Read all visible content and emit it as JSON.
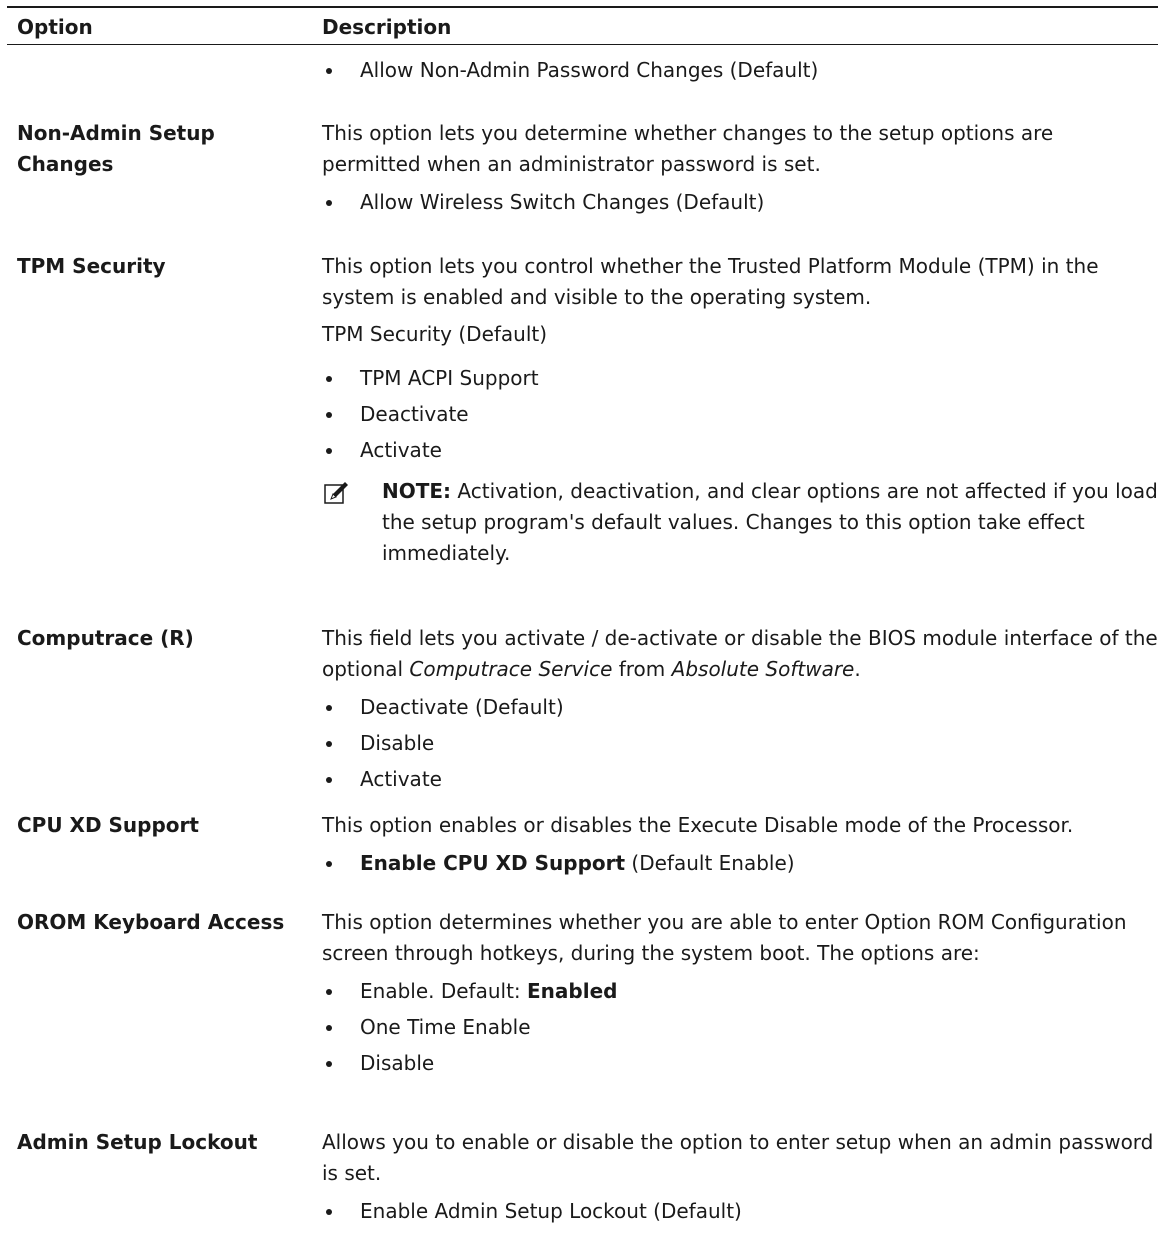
{
  "header": {
    "option": "Option",
    "description": "Description"
  },
  "rows": {
    "r0": {
      "bullets": [
        "Allow Non-Admin Password Changes (Default)"
      ]
    },
    "r1": {
      "label_l1": "Non-Admin Setup",
      "label_l2": "Changes",
      "text": "This option lets you determine whether changes to the setup options are permitted when an administrator password is set.",
      "bullets": [
        "Allow Wireless Switch Changes (Default)"
      ]
    },
    "r2": {
      "label": "TPM Security",
      "text": "This option lets you control whether the Trusted Platform Module (TPM) in the system is enabled and visible to the operating system.",
      "text2": "TPM Security (Default)",
      "bullets": [
        "TPM ACPI Support",
        "Deactivate",
        "Activate"
      ],
      "note_label": "NOTE:",
      "note_text": "Activation, deactivation, and clear options are not affected if you load the setup program's default values. Changes to this option take effect immediately."
    },
    "r3": {
      "label": "Computrace (R)",
      "text_a": "This field lets you activate / de-activate or disable the BIOS module interface of the optional ",
      "text_b": "Computrace Service",
      "text_c": " from ",
      "text_d": "Absolute Software",
      "text_e": ".",
      "bullets": [
        "Deactivate (Default)",
        "Disable",
        "Activate"
      ]
    },
    "r4": {
      "label": "CPU XD Support",
      "text": "This option enables or disables the Execute Disable mode of the Processor.",
      "bullet_bold": "Enable CPU XD Support",
      "bullet_rest": " (Default Enable)"
    },
    "r5": {
      "label": "OROM Keyboard Access",
      "text": "This option determines whether you are able to enter Option ROM Configuration screen through hotkeys, during the system boot. The options are:",
      "bullet1_a": "Enable. Default: ",
      "bullet1_b": "Enabled",
      "bullets": [
        "One Time Enable",
        "Disable"
      ]
    },
    "r6": {
      "label": "Admin Setup Lockout",
      "text": "Allows you to enable or disable the option to enter setup when an admin password is set.",
      "bullets": [
        "Enable Admin Setup Lockout (Default)"
      ]
    }
  },
  "icons": {
    "note": "pencil-note-icon"
  }
}
